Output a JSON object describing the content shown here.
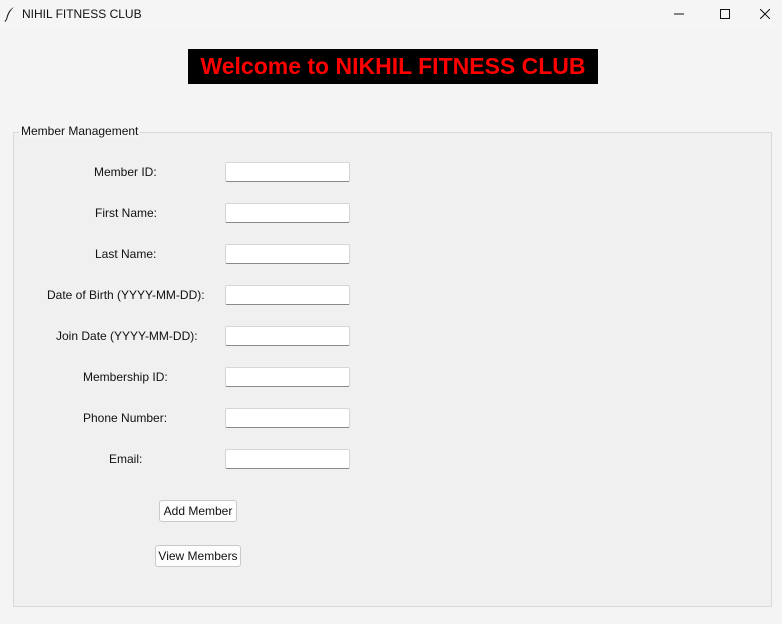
{
  "window": {
    "title": "NIHIL FITNESS CLUB",
    "icon": "feather-icon",
    "controls": [
      "minimize-icon",
      "maximize-icon",
      "close-icon"
    ]
  },
  "header": {
    "welcome": "Welcome to NIKHIL FITNESS CLUB",
    "colors": {
      "background": "#000000",
      "text": "#ff0000"
    }
  },
  "form": {
    "legend": "Member Management",
    "fields": [
      {
        "label": "Member ID:",
        "value": ""
      },
      {
        "label": "First Name:",
        "value": ""
      },
      {
        "label": "Last Name:",
        "value": ""
      },
      {
        "label": "Date of Birth (YYYY-MM-DD):",
        "value": ""
      },
      {
        "label": "Join Date (YYYY-MM-DD):",
        "value": ""
      },
      {
        "label": "Membership ID:",
        "value": ""
      },
      {
        "label": "Phone Number:",
        "value": ""
      },
      {
        "label": "Email:",
        "value": ""
      }
    ],
    "buttons": {
      "add": "Add Member",
      "view": "View Members"
    }
  }
}
